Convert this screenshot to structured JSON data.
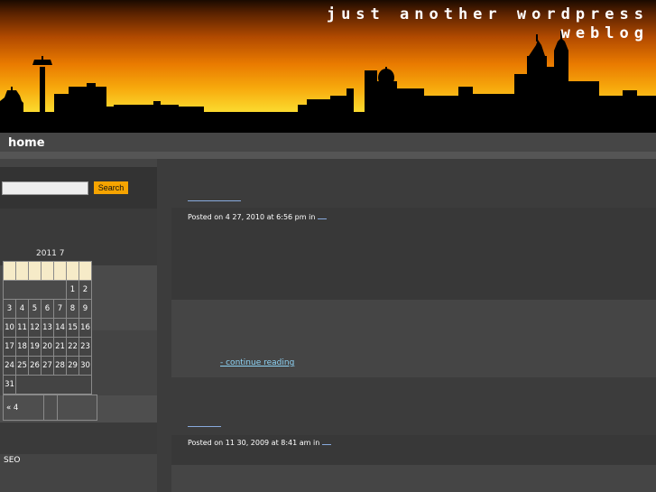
{
  "header": {
    "title_line1": "just another wordpress",
    "title_line2": "weblog"
  },
  "nav": {
    "home": "home"
  },
  "sidebar": {
    "search_button": "Search",
    "search_placeholder": "",
    "calendar": {
      "caption": "2011 7",
      "rows": [
        [
          "",
          "",
          "",
          "",
          "",
          "1",
          "2"
        ],
        [
          "3",
          "4",
          "5",
          "6",
          "7",
          "8",
          "9"
        ],
        [
          "10",
          "11",
          "12",
          "13",
          "14",
          "15",
          "16"
        ],
        [
          "17",
          "18",
          "19",
          "20",
          "21",
          "22",
          "23"
        ],
        [
          "24",
          "25",
          "26",
          "27",
          "28",
          "29",
          "30"
        ],
        [
          "31",
          "",
          "",
          "",
          "",
          "",
          ""
        ]
      ],
      "prev_link": "« 4"
    },
    "seo_label": "SEO"
  },
  "posts": [
    {
      "meta": "Posted on 4  27, 2010 at 6:56 pm in",
      "continue": "- continue reading"
    },
    {
      "meta": "Posted on 11  30, 2009 at 8:41 am in"
    }
  ],
  "colors": {
    "accent": "#f6a400",
    "link": "#8ed4f6"
  }
}
